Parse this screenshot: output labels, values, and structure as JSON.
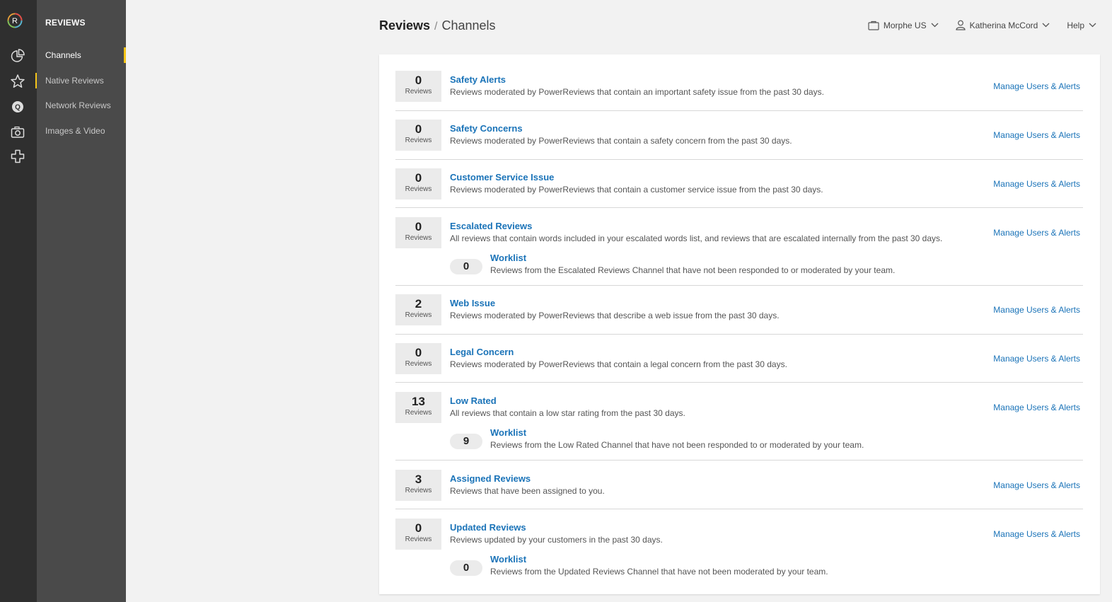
{
  "app": {
    "section_title": "REVIEWS",
    "logo_letter": "R"
  },
  "rail_icons": [
    "pie-chart-icon",
    "star-icon",
    "q-circle-icon",
    "camera-icon",
    "puzzle-icon"
  ],
  "subnav": {
    "items": [
      {
        "label": "Channels",
        "active": true
      },
      {
        "label": "Native Reviews",
        "active": false
      },
      {
        "label": "Network Reviews",
        "active": false
      },
      {
        "label": "Images & Video",
        "active": false
      }
    ]
  },
  "breadcrumb": {
    "parent": "Reviews",
    "separator": "/",
    "current": "Channels"
  },
  "topbar": {
    "store": "Morphe US",
    "user": "Katherina McCord",
    "help": "Help"
  },
  "channels": [
    {
      "count": "0",
      "count_label": "Reviews",
      "name": "Safety Alerts",
      "description": "Reviews moderated by PowerReviews that contain an important safety issue from the past 30 days.",
      "manage": "Manage Users & Alerts"
    },
    {
      "count": "0",
      "count_label": "Reviews",
      "name": "Safety Concerns",
      "description": "Reviews moderated by PowerReviews that contain a safety concern from the past 30 days.",
      "manage": "Manage Users & Alerts"
    },
    {
      "count": "0",
      "count_label": "Reviews",
      "name": "Customer Service Issue",
      "description": "Reviews moderated by PowerReviews that contain a customer service issue from the past 30 days.",
      "manage": "Manage Users & Alerts"
    },
    {
      "count": "0",
      "count_label": "Reviews",
      "name": "Escalated Reviews",
      "description": "All reviews that contain words included in your escalated words list, and reviews that are escalated internally from the past 30 days.",
      "manage": "Manage Users & Alerts",
      "worklist": {
        "count": "0",
        "name": "Worklist",
        "description": "Reviews from the Escalated Reviews Channel that have not been responded to or moderated by your team."
      }
    },
    {
      "count": "2",
      "count_label": "Reviews",
      "name": "Web Issue",
      "description": "Reviews moderated by PowerReviews that describe a web issue from the past 30 days.",
      "manage": "Manage Users & Alerts"
    },
    {
      "count": "0",
      "count_label": "Reviews",
      "name": "Legal Concern",
      "description": "Reviews moderated by PowerReviews that contain a legal concern from the past 30 days.",
      "manage": "Manage Users & Alerts"
    },
    {
      "count": "13",
      "count_label": "Reviews",
      "name": "Low Rated",
      "description": "All reviews that contain a low star rating from the past 30 days.",
      "manage": "Manage Users & Alerts",
      "worklist": {
        "count": "9",
        "name": "Worklist",
        "description": "Reviews from the Low Rated Channel that have not been responded to or moderated by your team."
      }
    },
    {
      "count": "3",
      "count_label": "Reviews",
      "name": "Assigned Reviews",
      "description": "Reviews that have been assigned to you.",
      "manage": "Manage Users & Alerts"
    },
    {
      "count": "0",
      "count_label": "Reviews",
      "name": "Updated Reviews",
      "description": "Reviews updated by your customers in the past 30 days.",
      "manage": "Manage Users & Alerts",
      "worklist": {
        "count": "0",
        "name": "Worklist",
        "description": "Reviews from the Updated Reviews Channel that have not been moderated by your team."
      }
    }
  ]
}
